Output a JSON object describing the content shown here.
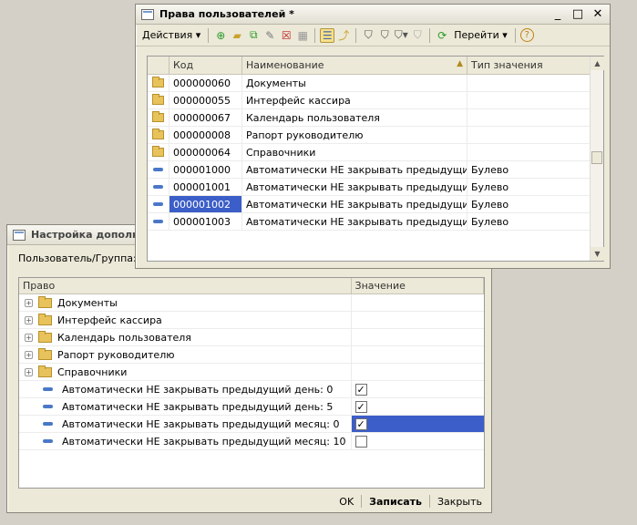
{
  "back_window": {
    "title": "Настройка дополни",
    "filter_label": "Пользователь/Группа:",
    "columns": {
      "right": "Право",
      "value": "Значение"
    },
    "rows": [
      {
        "type": "folder",
        "label": "Документы",
        "checked": null
      },
      {
        "type": "folder",
        "label": "Интерфейс кассира",
        "checked": null
      },
      {
        "type": "folder",
        "label": "Календарь пользователя",
        "checked": null
      },
      {
        "type": "folder",
        "label": "Рапорт руководителю",
        "checked": null
      },
      {
        "type": "folder",
        "label": "Справочники",
        "checked": null
      },
      {
        "type": "leaf",
        "label": "Автоматически НЕ закрывать предыдущий день: 0",
        "checked": true
      },
      {
        "type": "leaf",
        "label": "Автоматически НЕ закрывать предыдущий день: 5",
        "checked": true
      },
      {
        "type": "leaf",
        "label": "Автоматически НЕ закрывать предыдущий месяц: 0",
        "checked": true,
        "selected": true
      },
      {
        "type": "leaf",
        "label": "Автоматически НЕ закрывать предыдущий месяц: 10",
        "checked": false
      }
    ],
    "buttons": {
      "ok": "OK",
      "save": "Записать",
      "close": "Закрыть"
    }
  },
  "front_window": {
    "title": "Права пользователей *",
    "toolbar": {
      "actions": "Действия",
      "goto": "Перейти"
    },
    "columns": {
      "code": "Код",
      "name": "Наименование",
      "type": "Тип значения"
    },
    "rows": [
      {
        "icon": "folder",
        "code": "000000060",
        "name": "Документы",
        "type": ""
      },
      {
        "icon": "folder",
        "code": "000000055",
        "name": "Интерфейс кассира",
        "type": ""
      },
      {
        "icon": "folder",
        "code": "000000067",
        "name": "Календарь пользователя",
        "type": ""
      },
      {
        "icon": "folder",
        "code": "000000008",
        "name": "Рапорт руководителю",
        "type": ""
      },
      {
        "icon": "folder",
        "code": "000000064",
        "name": "Справочники",
        "type": ""
      },
      {
        "icon": "item",
        "code": "000001000",
        "name": "Автоматически НЕ закрывать предыдущий ...",
        "type": "Булево"
      },
      {
        "icon": "item",
        "code": "000001001",
        "name": "Автоматически НЕ закрывать предыдущий ...",
        "type": "Булево"
      },
      {
        "icon": "item",
        "code": "000001002",
        "name": "Автоматически НЕ закрывать предыдущий ...",
        "type": "Булево",
        "selected": true
      },
      {
        "icon": "item",
        "code": "000001003",
        "name": "Автоматически НЕ закрывать предыдущий ...",
        "type": "Булево"
      }
    ]
  },
  "colors": {
    "selection": "#3c5ec8",
    "folder": "#e8c25a",
    "item_icon": "#4a78c8"
  }
}
